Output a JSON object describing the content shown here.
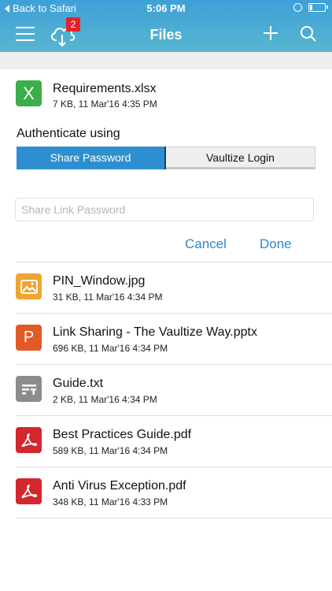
{
  "status_bar": {
    "back_label": "Back to Safari",
    "time": "5:06 PM",
    "battery_level": 0.2
  },
  "nav": {
    "title": "Files",
    "upload_badge": "2"
  },
  "selected_file": {
    "name": "Requirements.xlsx",
    "meta": "7 KB, 11 Mar'16 4:35 PM",
    "icon_letter": "X",
    "icon_color": "#3aae49"
  },
  "auth": {
    "label": "Authenticate using",
    "options": [
      "Share Password",
      "Vaultize Login"
    ],
    "selected": "Share Password",
    "password_placeholder": "Share Link Password",
    "password_value": "",
    "cancel_label": "Cancel",
    "done_label": "Done"
  },
  "files": [
    {
      "name": "PIN_Window.jpg",
      "meta": "31 KB, 11 Mar'16 4:34 PM",
      "icon": "image-icon",
      "color": "#f0a431"
    },
    {
      "name": "Link Sharing - The Vaultize Way.pptx",
      "meta": "696 KB, 11 Mar'16 4:34 PM",
      "icon": "powerpoint-icon",
      "letter": "P",
      "color": "#e25a26"
    },
    {
      "name": "Guide.txt",
      "meta": "2 KB, 11 Mar'16 4:34 PM",
      "icon": "text-file-icon",
      "color": "#8c8c8c"
    },
    {
      "name": "Best Practices Guide.pdf",
      "meta": "589 KB, 11 Mar'16 4:34 PM",
      "icon": "pdf-icon",
      "color": "#d2272d"
    },
    {
      "name": "Anti Virus Exception.pdf",
      "meta": "348 KB, 11 Mar'16 4:33 PM",
      "icon": "pdf-icon",
      "color": "#d2272d"
    }
  ],
  "colors": {
    "header_top": "#3ea0d7",
    "header_bottom": "#58b6cf",
    "accent": "#2e8fd0",
    "link": "#2e86c9"
  }
}
